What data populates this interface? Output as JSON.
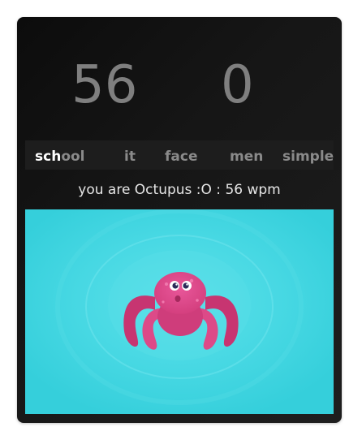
{
  "stats": {
    "wpm": "56",
    "errors": "0"
  },
  "words": [
    {
      "typed": "sch",
      "rest": "ool"
    },
    {
      "typed": "",
      "rest": "it"
    },
    {
      "typed": "",
      "rest": "face"
    },
    {
      "typed": "",
      "rest": "men"
    },
    {
      "typed": "",
      "rest": "simple"
    }
  ],
  "result": {
    "text": "you are Octupus :O : 56 wpm"
  },
  "animal": {
    "icon": "octopus-icon",
    "body_color": "#e04f8d",
    "water_color": "#3fd3df"
  },
  "colors": {
    "score_text": "#7f7f7f",
    "typed_text": "#ffffff",
    "pending_text": "#8a8a8a"
  }
}
